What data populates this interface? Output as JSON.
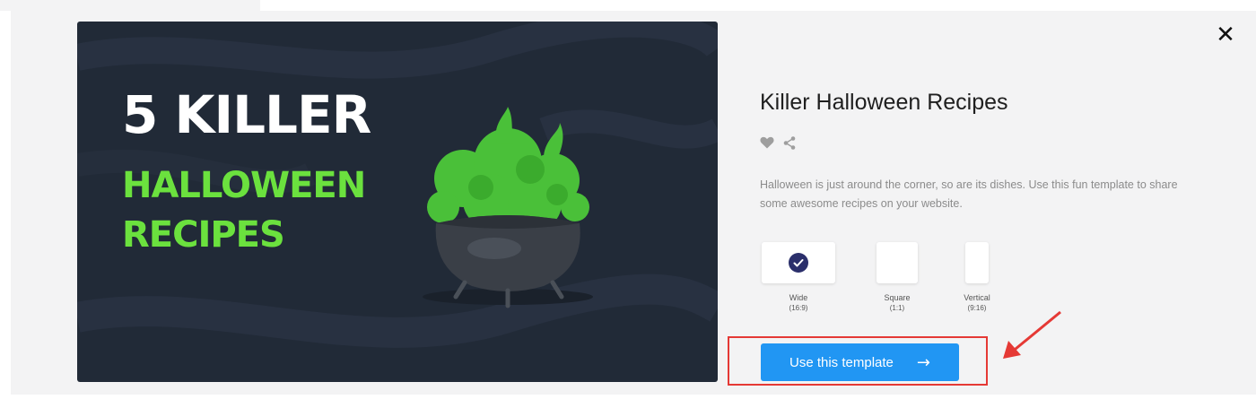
{
  "preview": {
    "headline_line1": "5 KILLER",
    "headline_line2": "HALLOWEEN",
    "headline_line3": "RECIPES",
    "background_color": "#212a37",
    "accent_green": "#6be13e"
  },
  "close": {
    "label": "✕"
  },
  "template": {
    "title": "Killer Halloween Recipes",
    "description": "Halloween is just around the corner, so are its dishes. Use this fun template to share some awesome recipes on your website.",
    "icons": [
      "heart-icon",
      "share-icon"
    ]
  },
  "formats": [
    {
      "label": "Wide",
      "ratio": "(16:9)",
      "selected": true
    },
    {
      "label": "Square",
      "ratio": "(1:1)",
      "selected": false
    },
    {
      "label": "Vertical",
      "ratio": "(9:16)",
      "selected": false
    }
  ],
  "cta": {
    "label": "Use this template",
    "arrow": "→",
    "color": "#2196f3"
  },
  "annotation": {
    "highlight_color": "#e53935"
  }
}
